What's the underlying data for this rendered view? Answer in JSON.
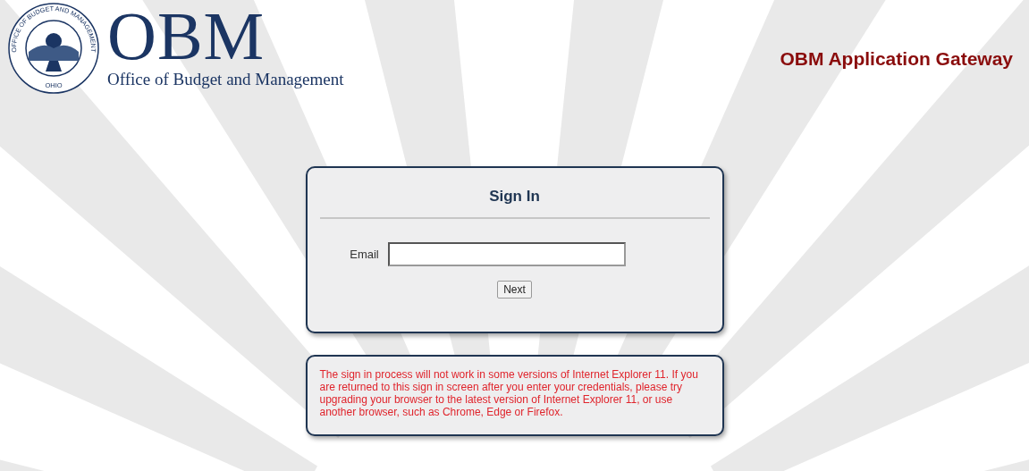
{
  "header": {
    "seal": {
      "ring_text": "OFFICE OF BUDGET AND MANAGEMENT",
      "bottom_text": "OHIO"
    },
    "logo_text": "OBM",
    "logo_subtitle": "Office of Budget and Management",
    "app_title": "OBM Application Gateway"
  },
  "sign_in": {
    "title": "Sign In",
    "email_label": "Email",
    "button": "Next"
  },
  "notice": "The sign in process will not work in some versions of Internet Explorer 11. If you are returned to this sign in screen after you enter your credentials, please try upgrading your browser to the latest version of Internet Explorer 11, or use another browser, such as Chrome, Edge or Firefox."
}
